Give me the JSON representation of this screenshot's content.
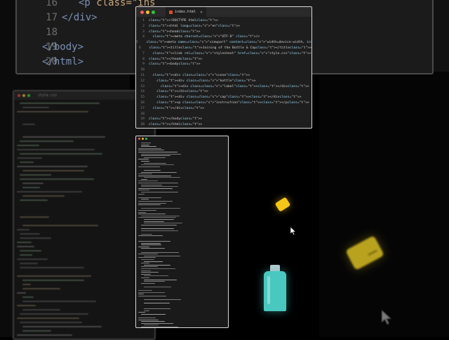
{
  "background_code": {
    "line_numbers": [
      "16",
      "17",
      "18",
      "19",
      "20"
    ],
    "lines": [
      {
        "tag": "<p ",
        "attr": "class=\"ins"
      },
      {
        "tag": "</div>",
        "attr": ""
      },
      {
        "tag": "",
        "attr": ""
      },
      {
        "tag": "</body>",
        "attr": ""
      },
      {
        "tag": "</html>",
        "attr": ""
      }
    ],
    "side_tab": "style.css"
  },
  "editor": {
    "tab_label": "index.html",
    "tab_close": "×",
    "colors": {
      "red": "#ff5f57",
      "yellow": "#febc2e",
      "green": "#28c840"
    },
    "lines": [
      {
        "num": "1",
        "indent": "",
        "text": "<!DOCTYPE html>"
      },
      {
        "num": "2",
        "indent": "",
        "text": "<html lang=\"en\">"
      },
      {
        "num": "3",
        "indent": "",
        "text": "<head>"
      },
      {
        "num": "4",
        "indent": "  ",
        "text": "<meta charset=\"UTF-8\" />"
      },
      {
        "num": "5",
        "indent": "  ",
        "text": "<meta name=\"viewport\" content=\"width=device-width, initial-scale=1.0\" />"
      },
      {
        "num": "6",
        "indent": "  ",
        "text": "<title>Joining of the Bottle & Cap</title>"
      },
      {
        "num": "7",
        "indent": "  ",
        "text": "<link rel=\"stylesheet\" href=\"style.css\">"
      },
      {
        "num": "8",
        "indent": "",
        "text": "</head>"
      },
      {
        "num": "9",
        "indent": "",
        "text": "<body>"
      },
      {
        "num": "10",
        "indent": "",
        "text": ""
      },
      {
        "num": "11",
        "indent": "  ",
        "text": "<div class=\"scene\">"
      },
      {
        "num": "12",
        "indent": "    ",
        "text": "<div class=\"bottle\">"
      },
      {
        "num": "13",
        "indent": "      ",
        "text": "<div class=\"label\"></div>"
      },
      {
        "num": "14",
        "indent": "    ",
        "text": "</div>"
      },
      {
        "num": "15",
        "indent": "    ",
        "text": "<div class=\"cap\"></div>"
      },
      {
        "num": "16",
        "indent": "    ",
        "text": "<p class=\"instruction\"></p>"
      },
      {
        "num": "17",
        "indent": "  ",
        "text": "</div>"
      },
      {
        "num": "18",
        "indent": "",
        "text": ""
      },
      {
        "num": "19",
        "indent": "",
        "text": "</body>"
      },
      {
        "num": "20",
        "indent": "",
        "text": "</html>"
      }
    ]
  },
  "scene": {
    "cap_color": "#f5c518",
    "bottle_color": "#49c8c0"
  }
}
